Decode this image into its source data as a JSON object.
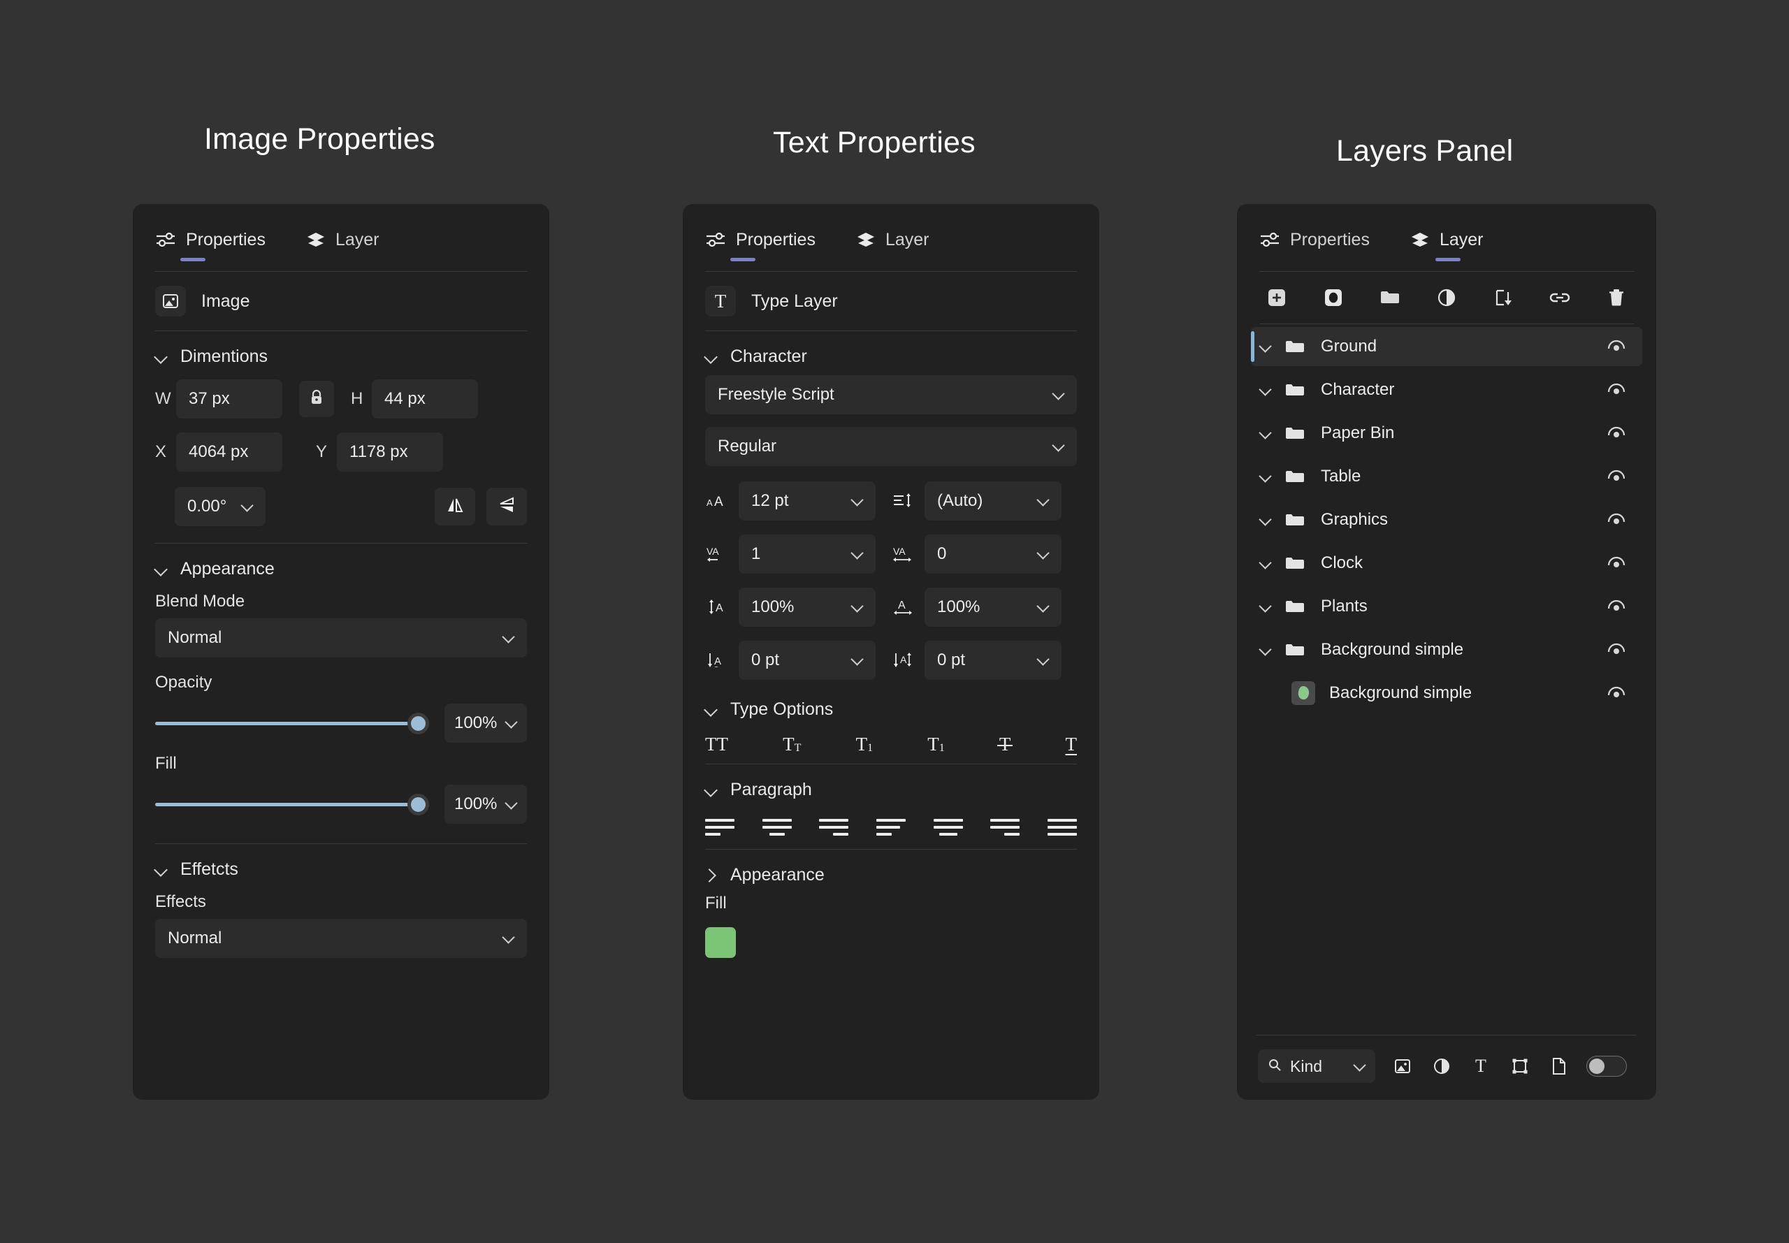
{
  "titles": {
    "image_properties": "Image Properties",
    "text_properties": "Text Properties",
    "layers_panel": "Layers Panel"
  },
  "tabs": {
    "properties": "Properties",
    "layer": "Layer"
  },
  "image_panel": {
    "layer_type": "Image",
    "dimensions": {
      "heading": "Dimentions",
      "w_label": "W",
      "w_value": "37 px",
      "h_label": "H",
      "h_value": "44 px",
      "x_label": "X",
      "x_value": "4064 px",
      "y_label": "Y",
      "y_value": "1178 px",
      "rotation": "0.00°"
    },
    "appearance": {
      "heading": "Appearance",
      "blend_mode_label": "Blend Mode",
      "blend_mode_value": "Normal",
      "opacity_label": "Opacity",
      "opacity_value": "100%",
      "fill_label": "Fill",
      "fill_value": "100%"
    },
    "effects": {
      "heading": "Effetcts",
      "label": "Effects",
      "value": "Normal"
    }
  },
  "text_panel": {
    "layer_type": "Type Layer",
    "character": {
      "heading": "Character",
      "font_family": "Freestyle Script",
      "font_style": "Regular",
      "size": "12 pt",
      "leading": "(Auto)",
      "kerning": "1",
      "tracking": "0",
      "vertical_scale": "100%",
      "horizontal_scale": "100%",
      "baseline_shift": "0 pt",
      "extra": "0 pt"
    },
    "type_options": {
      "heading": "Type Options",
      "buttons": [
        "TT",
        "Tт",
        "T1",
        "T1",
        "T",
        "T"
      ]
    },
    "paragraph": {
      "heading": "Paragraph"
    },
    "appearance": {
      "heading": "Appearance",
      "fill_label": "Fill",
      "fill_color": "#7cc576"
    }
  },
  "layers_panel": {
    "toolbar": [
      "add-layer",
      "add-mask",
      "new-group",
      "new-adjustment",
      "clipping",
      "link-layers",
      "delete-layer"
    ],
    "layers": [
      {
        "name": "Ground",
        "type": "group",
        "selected": true
      },
      {
        "name": "Character",
        "type": "group",
        "selected": false
      },
      {
        "name": "Paper Bin",
        "type": "group",
        "selected": false
      },
      {
        "name": "Table",
        "type": "group",
        "selected": false
      },
      {
        "name": "Graphics",
        "type": "group",
        "selected": false
      },
      {
        "name": "Clock",
        "type": "group",
        "selected": false
      },
      {
        "name": "Plants",
        "type": "group",
        "selected": false
      },
      {
        "name": "Background simple",
        "type": "group",
        "selected": false
      },
      {
        "name": "Background simple",
        "type": "image",
        "selected": false
      }
    ],
    "filter": {
      "kind_label": "Kind",
      "icons": [
        "image-filter",
        "adjustment-filter",
        "type-filter",
        "shape-filter",
        "smart-object-filter"
      ],
      "toggle_on": false
    }
  },
  "colors": {
    "page_bg": "#333333",
    "panel_bg": "#212121",
    "field_bg": "#2c2c2c",
    "accent_underline": "#7b7fd4",
    "slider": "#9cbdd8",
    "selection_bar": "#8ab4d8",
    "fill_green": "#7cc576"
  }
}
